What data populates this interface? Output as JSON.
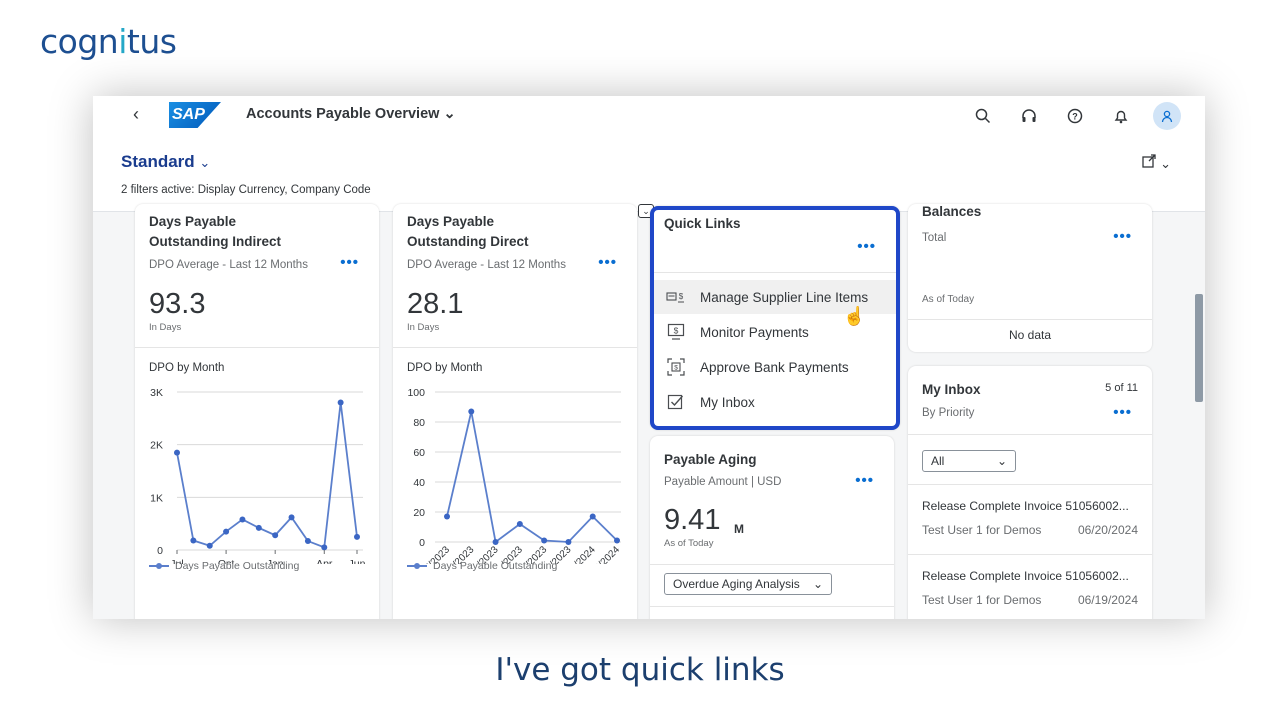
{
  "brand": {
    "logo_text_a": "cogn",
    "logo_text_b": "i",
    "logo_text_c": "tus"
  },
  "caption": "I've got quick links",
  "shell": {
    "back_icon": "chevron-left-icon",
    "logo": "SAP",
    "app_title": "Accounts Payable Overview",
    "icons": [
      "search-icon",
      "headset-icon",
      "help-icon",
      "bell-icon",
      "user-icon"
    ]
  },
  "header": {
    "variant": "Standard",
    "filters_text": "2 filters active: Display Currency, Company Code"
  },
  "cards": {
    "dpo_indirect": {
      "title_line1": "Days Payable",
      "title_line2": "Outstanding Indirect",
      "subtitle": "DPO Average - Last 12 Months",
      "kpi": "93.3",
      "kpi_unit": "In Days",
      "chart_title": "DPO by Month",
      "legend": "Days Payable Outstanding"
    },
    "dpo_direct": {
      "title_line1": "Days Payable",
      "title_line2": "Outstanding Direct",
      "subtitle": "DPO Average - Last 12 Months",
      "kpi": "28.1",
      "kpi_unit": "In Days",
      "chart_title": "DPO by Month",
      "legend": "Days Payable Outstanding"
    },
    "quick_links": {
      "title": "Quick Links",
      "items": [
        {
          "label": "Manage Supplier Line Items",
          "icon": "invoice-icon"
        },
        {
          "label": "Monitor Payments",
          "icon": "monitor-payment-icon"
        },
        {
          "label": "Approve Bank Payments",
          "icon": "approve-payment-icon"
        },
        {
          "label": "My Inbox",
          "icon": "checkbox-icon"
        }
      ]
    },
    "payable_aging": {
      "title": "Payable Aging",
      "subtitle": "Payable Amount | USD",
      "kpi": "9.41",
      "kpi_scale": "M",
      "kpi_unit": "As of Today",
      "select_value": "Overdue Aging Analysis"
    },
    "balances": {
      "title": "Balances",
      "subtitle": "Total",
      "as_of": "As of Today",
      "no_data": "No data"
    },
    "inbox": {
      "title": "My Inbox",
      "count": "5 of 11",
      "subtitle": "By Priority",
      "select_value": "All",
      "items": [
        {
          "title": "Release Complete Invoice 51056002...",
          "user": "Test User 1 for Demos",
          "date": "06/20/2024"
        },
        {
          "title": "Release Complete Invoice 51056002...",
          "user": "Test User 1 for Demos",
          "date": "06/19/2024"
        }
      ]
    }
  },
  "chart_data": [
    {
      "type": "line",
      "title": "DPO by Month",
      "x_tick_labels": [
        [
          "Jul",
          "2023"
        ],
        [
          "Oct",
          ""
        ],
        [
          "Jan",
          "2024"
        ],
        [
          "Apr",
          ""
        ],
        [
          "Jun",
          ""
        ]
      ],
      "y_tick_labels": [
        "0",
        "1K",
        "2K",
        "3K"
      ],
      "ylim": [
        0,
        3000
      ],
      "series": [
        {
          "name": "Days Payable Outstanding",
          "values": [
            1850,
            180,
            80,
            350,
            580,
            420,
            280,
            620,
            170,
            50,
            2800,
            250
          ]
        }
      ],
      "grid": true,
      "legend": "bottom"
    },
    {
      "type": "line",
      "title": "DPO by Month",
      "categories": [
        "07/2023",
        "08/2023",
        "09/2023",
        "10/2023",
        "11/2023",
        "12/2023",
        "03/2024",
        "06/2024"
      ],
      "y_tick_labels": [
        "0",
        "20",
        "40",
        "60",
        "80",
        "100"
      ],
      "ylim": [
        0,
        100
      ],
      "series": [
        {
          "name": "Days Payable Outstanding",
          "values": [
            17,
            87,
            0,
            12,
            1,
            0,
            17,
            1
          ]
        }
      ],
      "grid": true,
      "legend": "bottom"
    }
  ]
}
